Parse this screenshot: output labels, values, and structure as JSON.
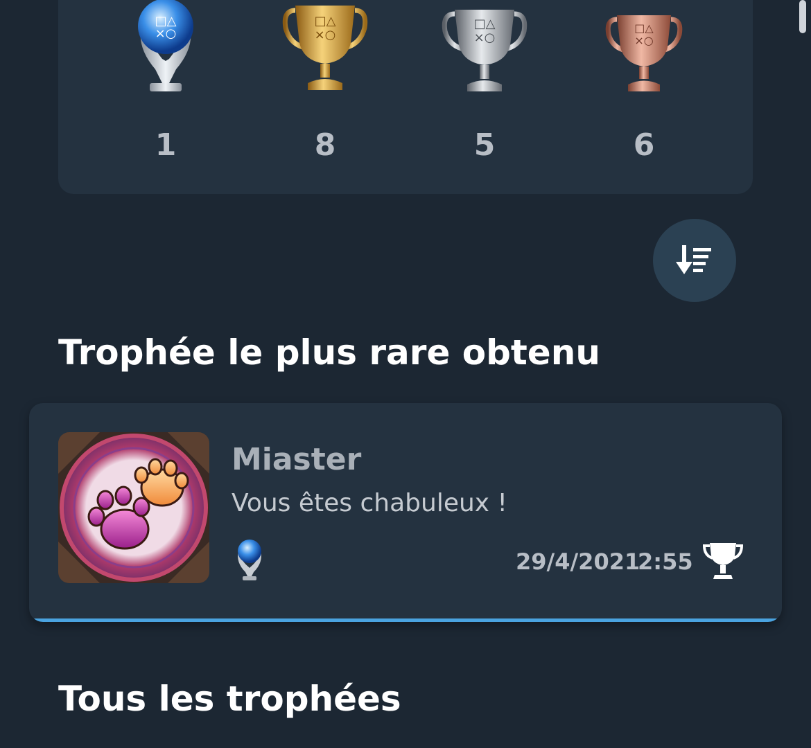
{
  "summary": {
    "trophies": [
      {
        "grade": "platinum",
        "icon": "platinum-trophy-icon",
        "count": "1"
      },
      {
        "grade": "gold",
        "icon": "gold-trophy-icon",
        "count": "8"
      },
      {
        "grade": "silver",
        "icon": "silver-trophy-icon",
        "count": "5"
      },
      {
        "grade": "bronze",
        "icon": "bronze-trophy-icon",
        "count": "6"
      }
    ]
  },
  "sort_button": {
    "icon": "sort-descending-icon"
  },
  "rarest_section": {
    "title": "Trophée le plus rare obtenu",
    "trophy": {
      "name": "Miaster",
      "description": "Vous êtes chabuleux !",
      "grade": "platinum",
      "date": "29/4/2021",
      "time": "2:55",
      "status_icon": "trophy-earned-icon"
    }
  },
  "all_section": {
    "title": "Tous les trophées"
  },
  "colors": {
    "background": "#1c2733",
    "card": "#243240",
    "accent": "#4aa3e0",
    "platinum": "#8fc4ff",
    "gold": "#d9a53a",
    "silver": "#b5b9bf",
    "bronze": "#c98370"
  }
}
